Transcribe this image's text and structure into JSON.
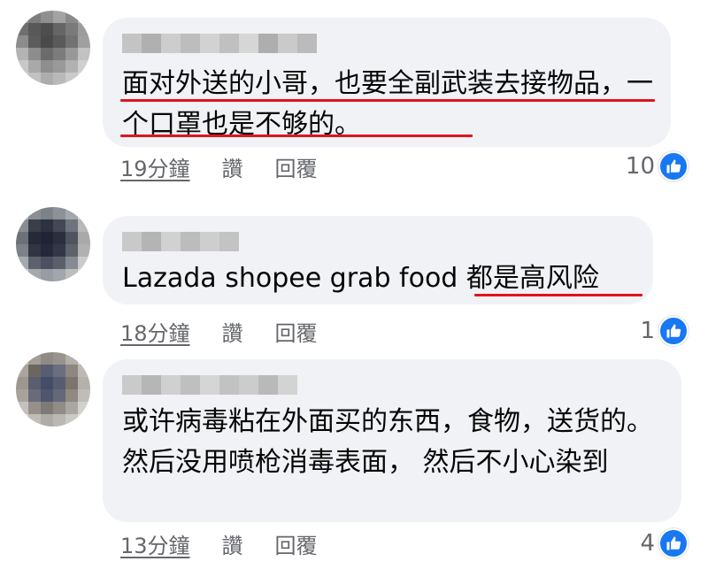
{
  "comments": [
    {
      "text": "面对外送的小哥，也要全副武装去接物品，一个口罩也是不够的。",
      "time": "19分鐘",
      "like_label": "讚",
      "reply_label": "回覆",
      "reaction_count": "10"
    },
    {
      "text": "Lazada shopee grab food 都是高风险",
      "time": "18分鐘",
      "like_label": "讚",
      "reply_label": "回覆",
      "reaction_count": "1"
    },
    {
      "text": "或许病毒粘在外面买的东西，食物，送货的。然后没用喷枪消毒表面， 然后不小心染到",
      "time": "13分鐘",
      "like_label": "讚",
      "reply_label": "回覆",
      "reaction_count": "4"
    }
  ],
  "colors": {
    "bubble": "#f0f2f5",
    "underline": "#e0141e",
    "like_blue": "#1877f2",
    "meta_gray": "#65676b"
  },
  "icons": [
    "thumbs-up-icon"
  ]
}
